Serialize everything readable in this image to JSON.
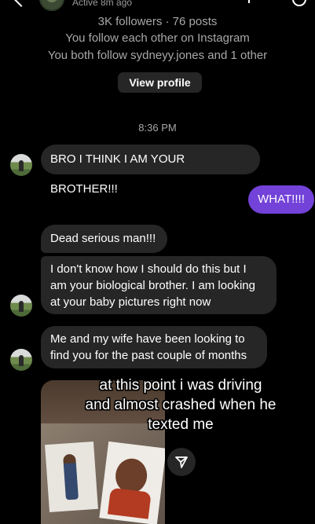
{
  "header": {
    "active_status": "Active 8m ago"
  },
  "profile": {
    "stats": "3K followers · 76 posts",
    "follow_status": "You follow each other on Instagram",
    "mutuals": "You both follow sydneyy.jones and 1 other",
    "view_profile_label": "View profile"
  },
  "thread": {
    "timestamp": "8:36 PM",
    "messages": [
      {
        "from": "them",
        "lines": [
          "BRO I THINK I AM YOUR BROTHER!!!"
        ]
      },
      {
        "from": "me",
        "lines": [
          "WHAT!!!!"
        ]
      },
      {
        "from": "them",
        "lines": [
          "Dead serious man!!!"
        ]
      },
      {
        "from": "them",
        "lines": [
          "I don't know how I should do this but I",
          "am your biological brother. I am looking",
          "at your baby pictures right now"
        ]
      },
      {
        "from": "them",
        "lines": [
          "Me and my wife have been looking to",
          "find you for the past couple of months"
        ]
      }
    ]
  },
  "caption_overlay": {
    "lines": [
      "at this point i was driving",
      "and almost crashed when he",
      "texted me"
    ]
  },
  "colors": {
    "background": "#000000",
    "incoming_bubble": "#262626",
    "outgoing_bubble": "#7342d8",
    "secondary_text": "#a8a8a8"
  },
  "icons": [
    "back-chevron-icon",
    "share-icon"
  ]
}
